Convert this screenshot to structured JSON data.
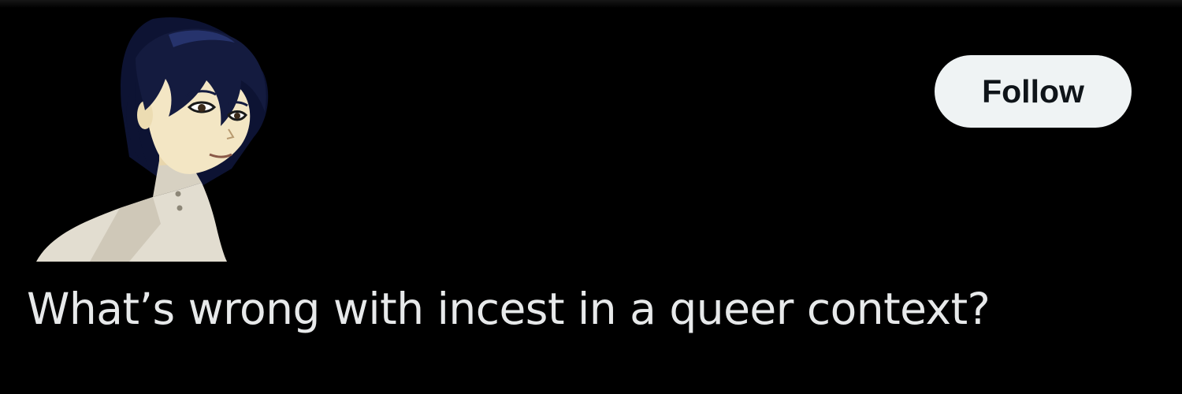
{
  "profile": {
    "avatar_icon": "anime-character-avatar",
    "follow_label": "Follow"
  },
  "post": {
    "text": "What’s wrong with incest in a queer context?"
  },
  "colors": {
    "background": "#000000",
    "text": "#e7e9ea",
    "button_bg": "#eff3f4",
    "button_text": "#0f1419",
    "hair": "#141b3f",
    "skin": "#f3e6c4",
    "jacket": "#e2ddd0"
  }
}
